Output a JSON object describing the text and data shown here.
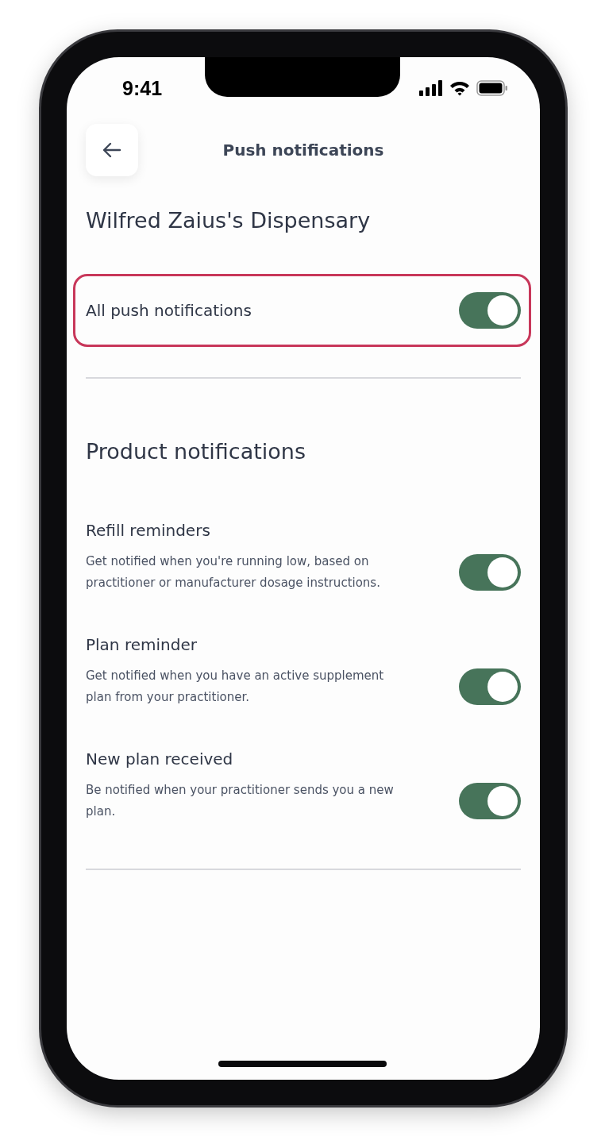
{
  "status_bar": {
    "time": "9:41"
  },
  "header": {
    "title": "Push notifications"
  },
  "dispensary": "Wilfred Zaius's Dispensary",
  "all_notifications": {
    "label": "All push notifications",
    "on": true
  },
  "section": {
    "title": "Product notifications",
    "items": [
      {
        "title": "Refill reminders",
        "description": "Get notified when you're running low, based on practitioner or manufacturer dosage instructions.",
        "on": true
      },
      {
        "title": "Plan reminder",
        "description": "Get notified when you have an active supplement plan from your practitioner.",
        "on": true
      },
      {
        "title": "New plan received",
        "description": "Be notified when your practitioner sends you a new plan.",
        "on": true
      }
    ]
  }
}
